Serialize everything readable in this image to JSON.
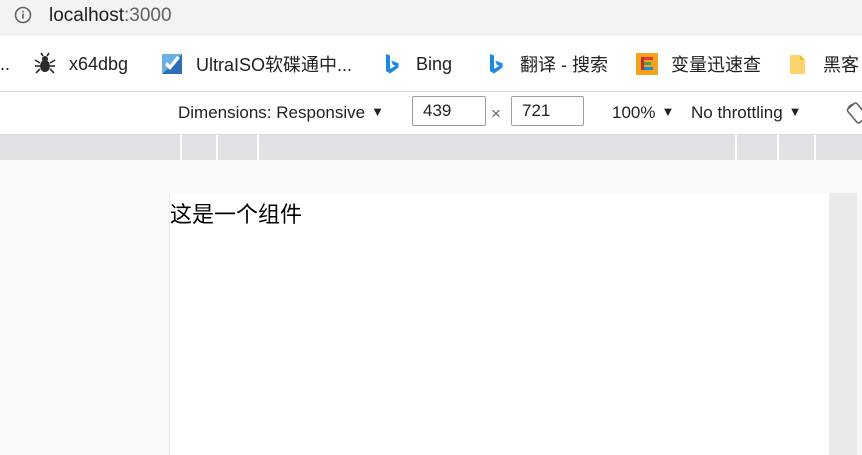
{
  "address_bar": {
    "host": "localhost",
    "port": ":3000"
  },
  "bookmarks": {
    "leading_ellipsis": "..",
    "items": [
      {
        "label": "x64dbg",
        "icon": "bug-icon"
      },
      {
        "label": "UltraISO软碟通中...",
        "icon": "ultraiso-icon"
      },
      {
        "label": "Bing",
        "icon": "bing-icon"
      },
      {
        "label": "翻译 - 搜索",
        "icon": "bing-icon"
      },
      {
        "label": "变量迅速查",
        "icon": "codelf-icon"
      },
      {
        "label": "黑客",
        "icon": "folder-icon"
      }
    ]
  },
  "devtools": {
    "dimensions_label": "Dimensions: Responsive",
    "width": "439",
    "height": "721",
    "times": "×",
    "zoom": "100%",
    "throttling": "No throttling",
    "caret": "▼"
  },
  "page": {
    "text": "这是一个组件"
  }
}
